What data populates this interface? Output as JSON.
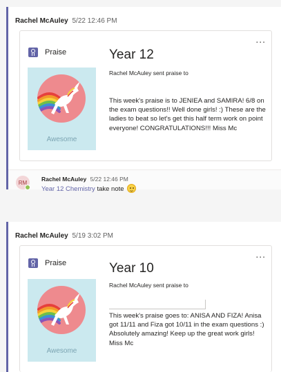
{
  "posts": [
    {
      "author": "Rachel McAuley",
      "timestamp": "5/22 12:46 PM",
      "card": {
        "tag": "Praise",
        "title": "Year 12",
        "sent_line": "Rachel McAuley sent praise to",
        "badge_label": "Awesome",
        "message": "This week's praise is to JENIEA and SAMIRA! 6/8 on the exam questions!! Well done girls! :) These are the ladies to beat so let's get this half term work on point everyone! CONGRATULATIONS!!! Miss Mc",
        "more": "..."
      },
      "reply": {
        "avatar_initials": "RM",
        "author": "Rachel McAuley",
        "timestamp": "5/22 12:46 PM",
        "channel_mention": "Year 12 Chemistry",
        "text": "take note",
        "emoji": "smile-emoji"
      }
    },
    {
      "author": "Rachel McAuley",
      "timestamp": "5/19 3:02 PM",
      "card": {
        "tag": "Praise",
        "title": "Year 10",
        "sent_line": "Rachel McAuley sent praise to",
        "badge_label": "Awesome",
        "message": "This week's praise goes to: ANISA AND FIZA! Anisa got 11/11 and Fiza got 10/11 in the exam questions :) Absolutely amazing! Keep up the great work girls! Miss Mc",
        "more": "..."
      }
    }
  ],
  "colors": {
    "accent": "#6264a7",
    "badge_bg": "#cbe9ef",
    "badge_circle": "#ee8a8e",
    "presence": "#92c353"
  },
  "icons": [
    "praise-badge-icon",
    "unicorn-icon",
    "more-options-icon",
    "presence-available-icon"
  ]
}
